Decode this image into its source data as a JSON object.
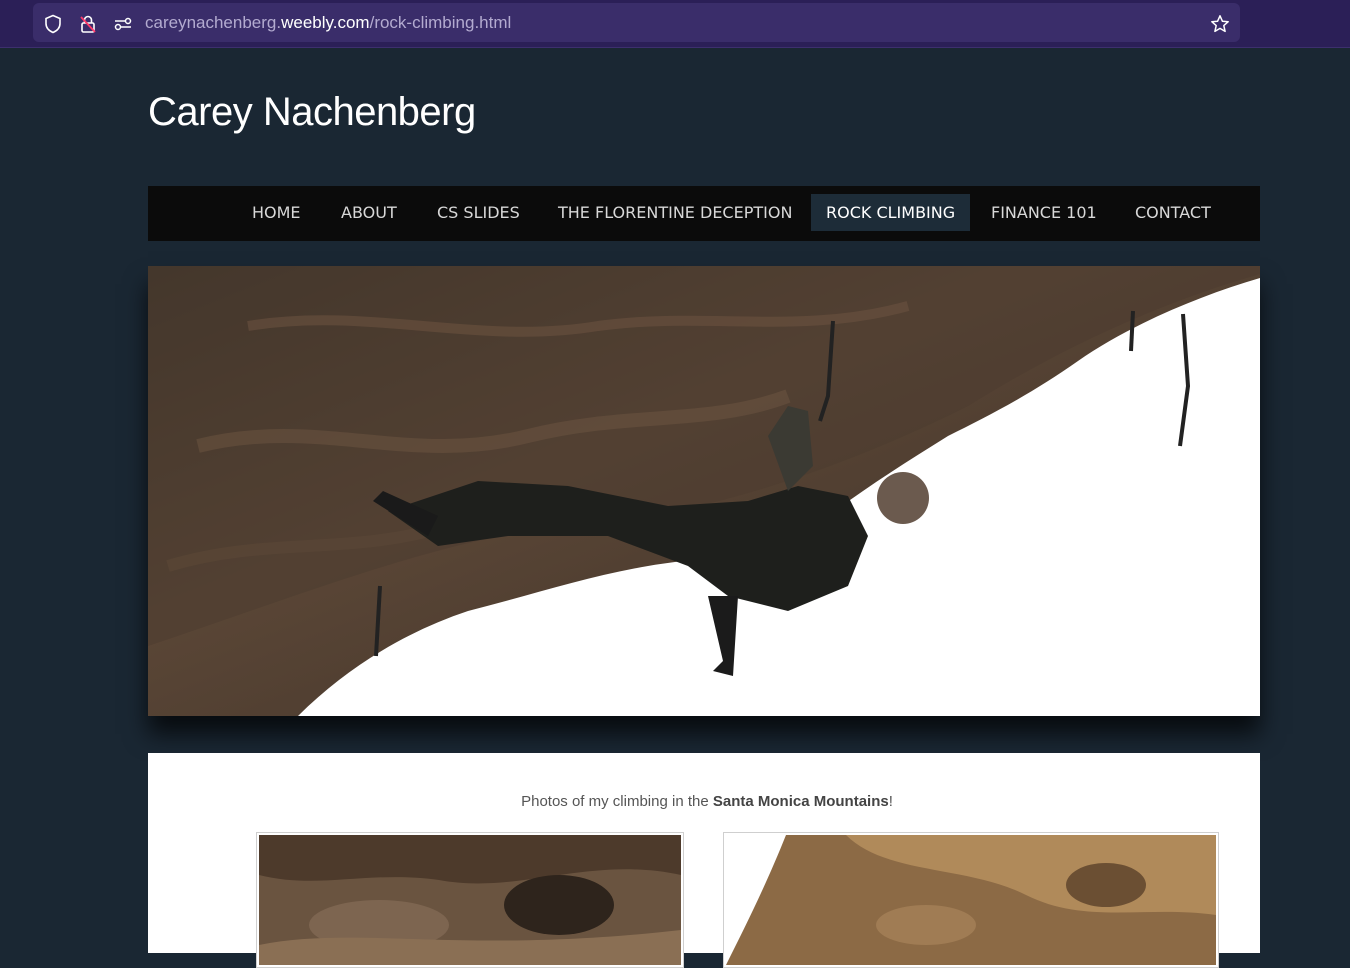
{
  "browser": {
    "url_prefix": "careynachenberg.",
    "url_domain": "weebly.com",
    "url_path": "/rock-climbing.html"
  },
  "site": {
    "title": "Carey Nachenberg"
  },
  "nav": {
    "items": [
      {
        "label": "HOME"
      },
      {
        "label": "ABOUT"
      },
      {
        "label": "CS SLIDES"
      },
      {
        "label": "THE FLORENTINE DECEPTION"
      },
      {
        "label": "ROCK CLIMBING"
      },
      {
        "label": "FINANCE 101"
      },
      {
        "label": "CONTACT"
      }
    ],
    "active_index": 4
  },
  "content": {
    "caption_prefix": "Photos of my climbing in the ",
    "caption_bold": "Santa Monica Mountains",
    "caption_suffix": "!"
  },
  "colors": {
    "page_bg": "#1a2733",
    "nav_bg": "#0b0b0b",
    "nav_active_bg": "#1d2c38",
    "browser_bg": "#2b1f57"
  }
}
